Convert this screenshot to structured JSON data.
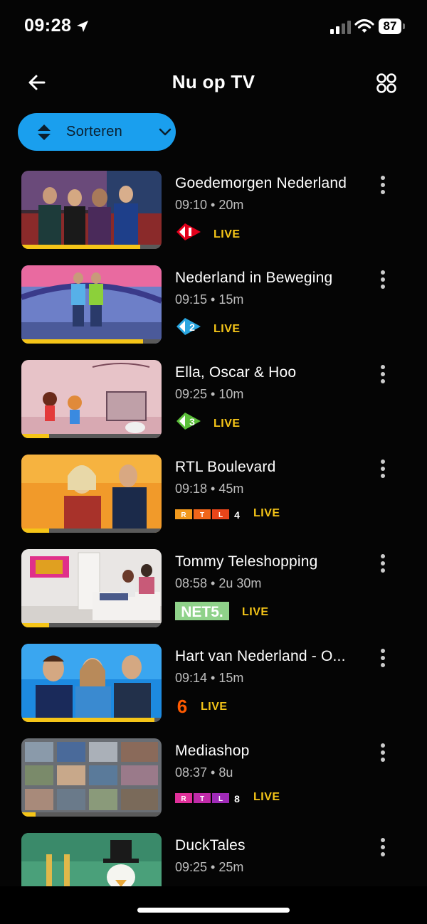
{
  "status": {
    "time": "09:28",
    "battery": "87"
  },
  "header": {
    "title": "Nu op TV"
  },
  "sort": {
    "label": "Sorteren"
  },
  "programs": [
    {
      "title": "Goedemorgen Nederland",
      "meta": "09:10 • 20m",
      "channel": "NPO 1",
      "live": "LIVE",
      "progress": 0.85
    },
    {
      "title": "Nederland in Beweging",
      "meta": "09:15 • 15m",
      "channel": "NPO 2",
      "live": "LIVE",
      "progress": 0.87
    },
    {
      "title": "Ella, Oscar & Hoo",
      "meta": "09:25 • 10m",
      "channel": "NPO 3",
      "live": "LIVE",
      "progress": 0.2
    },
    {
      "title": "RTL Boulevard",
      "meta": "09:18 • 45m",
      "channel": "RTL 4",
      "channel_num": "4",
      "live": "LIVE",
      "progress": 0.2
    },
    {
      "title": "Tommy Teleshopping",
      "meta": "08:58 • 2u 30m",
      "channel": "NET5",
      "channel_text": "NET5.",
      "live": "LIVE",
      "progress": 0.2
    },
    {
      "title": "Hart van Nederland - O...",
      "meta": "09:14 • 15m",
      "channel": "SBS6",
      "channel_text": "6",
      "live": "LIVE",
      "progress": 0.95
    },
    {
      "title": "Mediashop",
      "meta": "08:37 • 8u",
      "channel": "RTL 8",
      "channel_num": "8",
      "live": "LIVE",
      "progress": 0.1
    },
    {
      "title": "DuckTales",
      "meta": "09:25 • 25m"
    }
  ],
  "colors": {
    "accent": "#1a9fee",
    "live": "#f5c518",
    "npo_red": "#e3001b",
    "net5_green": "#8fd28a",
    "rtl4_orange": "#f39a1d",
    "rtl8_pink": "#e0309a",
    "sbs6_orange": "#ff5a00"
  },
  "icons": {
    "back": "arrow-left-icon",
    "grid": "grid-icon",
    "sort": "sort-updown-icon",
    "chevron": "chevron-down-icon",
    "more": "more-vertical-icon"
  }
}
